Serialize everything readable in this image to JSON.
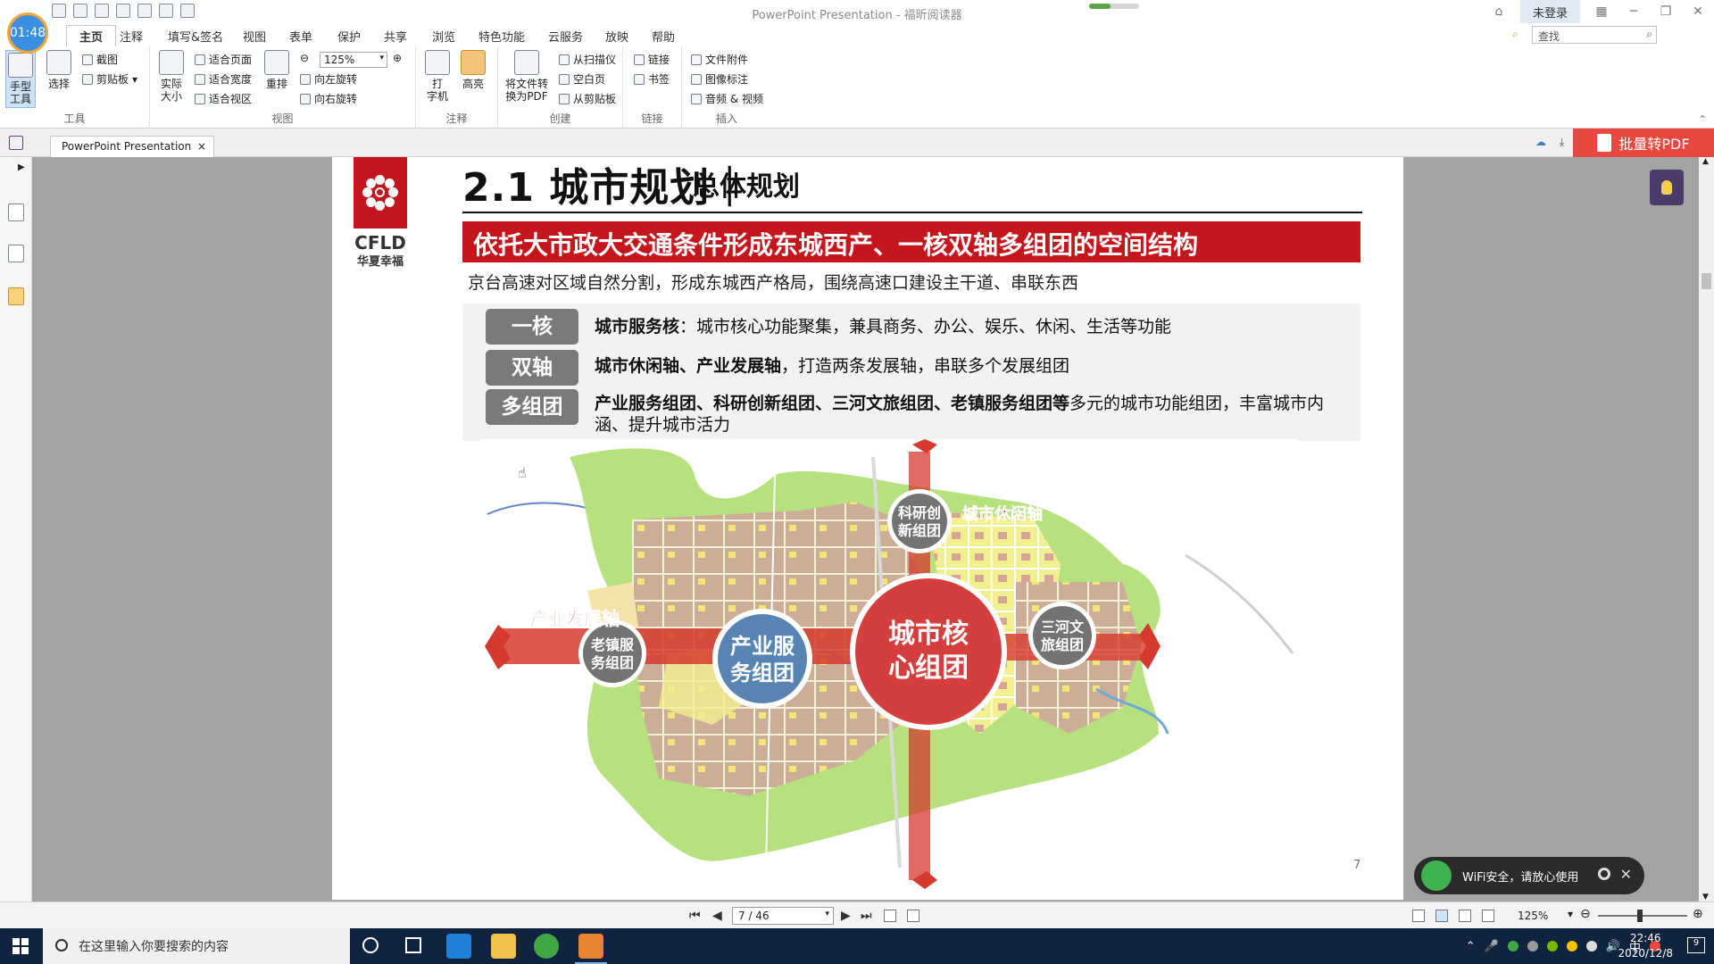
{
  "timer": "01:48",
  "window": {
    "title": "PowerPoint Presentation - 福昕阅读器",
    "login_label": "未登录",
    "search_placeholder": "查找"
  },
  "ribbon_tabs": [
    "主页",
    "注释",
    "填写&签名",
    "视图",
    "表单",
    "保护",
    "共享",
    "浏览",
    "特色功能",
    "云服务",
    "放映",
    "帮助"
  ],
  "ribbon": {
    "tools": {
      "label": "工具",
      "hand_line1": "手型",
      "hand_line2": "工具",
      "select": "选择",
      "screenshot": "截图",
      "clipboard": "剪贴板"
    },
    "view": {
      "label": "视图",
      "actual_line1": "实际",
      "actual_line2": "大小",
      "fit_page": "适合页面",
      "fit_width": "适合宽度",
      "fit_visible": "适合视区",
      "reflow": "重排",
      "zoom_value": "125%",
      "rotate_left": "向左旋转",
      "rotate_right": "向右旋转"
    },
    "comment": {
      "label": "注释",
      "typewriter_line1": "打",
      "typewriter_line2": "字机",
      "highlight": "高亮"
    },
    "create": {
      "label": "创建",
      "convert_line1": "将文件转",
      "convert_line2": "换为PDF",
      "from_scanner": "从扫描仪",
      "blank_page": "空白页",
      "from_clipboard": "从剪贴板"
    },
    "links": {
      "label": "链接",
      "link": "链接",
      "bookmark": "书签"
    },
    "insert": {
      "label": "插入",
      "file_attachment": "文件附件",
      "image_annotation": "图像标注",
      "audio_video": "音频 & 视频"
    }
  },
  "doc_tab": {
    "name": "PowerPoint Presentation",
    "close": "×"
  },
  "batch_pdf_label": "批量转PDF",
  "slide": {
    "logo_en": "CFLD",
    "logo_cn": "华夏幸福",
    "title": "2.1 城市规划｜",
    "subtitle": "总体规划",
    "banner": "依托大市政大交通条件形成东城西产、一核双轴多组团的空间结构",
    "caption": "京台高速对区域自然分割，形成东城西产格局，围绕高速口建设主干道、串联东西",
    "points": [
      {
        "badge": "一核",
        "bold": "城市服务核",
        "text": "：城市核心功能聚集，兼具商务、办公、娱乐、休闲、生活等功能"
      },
      {
        "badge": "双轴",
        "bold": "城市休闲轴、产业发展轴",
        "text": "，打造两条发展轴，串联多个发展组团"
      },
      {
        "badge": "多组团",
        "bold": "产业服务组团、科研创新组团、三河文旅组团、老镇服务组团等",
        "text": "多元的城市功能组团，丰富城市内涵、提升城市活力"
      }
    ],
    "map_labels": {
      "core": [
        "城市核",
        "心组团"
      ],
      "industry_service": [
        "产业服",
        "务组团"
      ],
      "old_town": [
        "老镇服",
        "务组团"
      ],
      "research": [
        "科研创",
        "新组团"
      ],
      "sanhe": [
        "三河文",
        "旅组团"
      ],
      "leisure_axis": "城市休闲轴",
      "industry_axis": "产业发展轴"
    },
    "page_number": "7"
  },
  "toast": {
    "text": "WiFi安全，请放心使用"
  },
  "status": {
    "page_field": "7 / 46",
    "zoom": "125%"
  },
  "taskbar": {
    "search_placeholder": "在这里输入你要搜索的内容",
    "time": "22:46",
    "date": "2020/12/8",
    "ime": "中",
    "notif_count": "9"
  }
}
